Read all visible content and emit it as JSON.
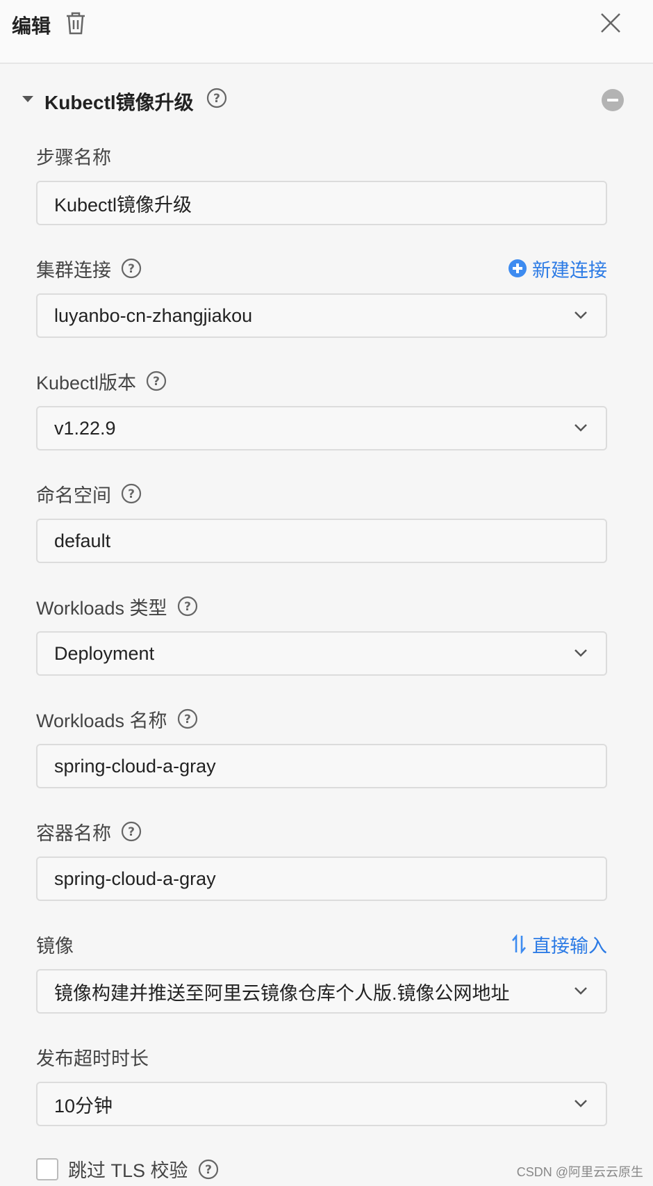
{
  "header": {
    "title": "编辑"
  },
  "section": {
    "title": "Kubectl镜像升级"
  },
  "fields": {
    "step_name": {
      "label": "步骤名称",
      "value": "Kubectl镜像升级"
    },
    "cluster": {
      "label": "集群连接",
      "value": "luyanbo-cn-zhangjiakou",
      "action": "新建连接"
    },
    "kubectl_version": {
      "label": "Kubectl版本",
      "value": "v1.22.9"
    },
    "namespace": {
      "label": "命名空间",
      "value": "default"
    },
    "workload_type": {
      "label": "Workloads 类型",
      "value": "Deployment"
    },
    "workload_name": {
      "label": "Workloads 名称",
      "value": "spring-cloud-a-gray"
    },
    "container_name": {
      "label": "容器名称",
      "value": "spring-cloud-a-gray"
    },
    "image": {
      "label": "镜像",
      "value": "镜像构建并推送至阿里云镜像仓库个人版.镜像公网地址",
      "action": "直接输入"
    },
    "timeout": {
      "label": "发布超时时长",
      "value": "10分钟"
    }
  },
  "skip_tls": {
    "label": "跳过 TLS 校验",
    "checked": false
  },
  "watermark": "CSDN @阿里云云原生",
  "colors": {
    "accent": "#2c7be5",
    "border": "#dcdcdc",
    "text": "#333333"
  }
}
